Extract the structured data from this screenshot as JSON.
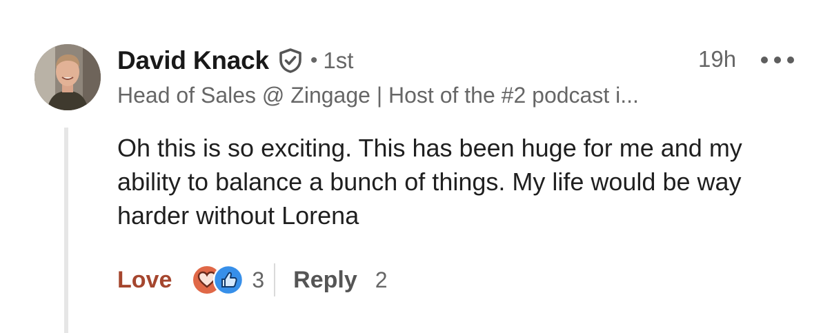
{
  "comment": {
    "author": "David Knack",
    "degree": "1st",
    "separator": "•",
    "timestamp": "19h",
    "headline": "Head of Sales @ Zingage | Host of the #2 podcast i...",
    "body": "Oh this is so exciting. This has been huge for me and my ability to balance a bunch of things. My life would be way harder without Lorena",
    "icons": {
      "verified": "verified-shield-icon",
      "more": "more-options-icon",
      "love": "heart-reaction-icon",
      "like": "thumbs-up-reaction-icon"
    }
  },
  "actions": {
    "reaction_label": "Love",
    "reaction_count": "3",
    "reply_label": "Reply",
    "reply_count": "2"
  },
  "colors": {
    "love_accent": "#a5462e",
    "love_badge": "#e06847",
    "like_badge": "#378fe9",
    "thread_line": "#e6e6e6",
    "secondary_text": "#666666"
  }
}
